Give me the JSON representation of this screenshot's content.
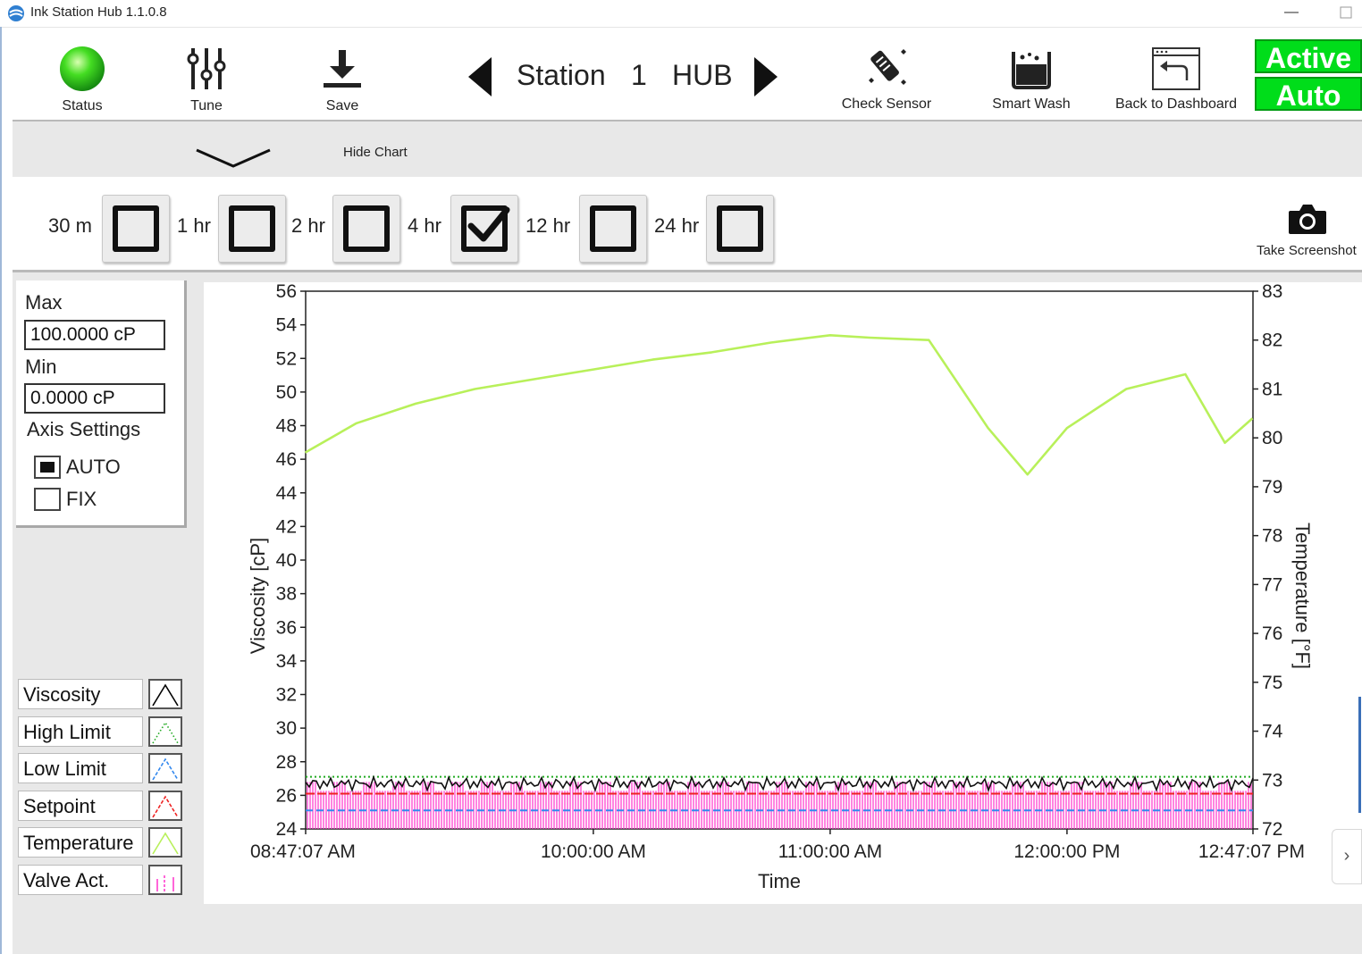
{
  "window": {
    "title": "Ink Station Hub 1.1.0.8",
    "minimize": "—"
  },
  "toolbar": {
    "status_label": "Status",
    "tune_label": "Tune",
    "save_label": "Save",
    "station_word": "Station",
    "station_number": "1",
    "station_name": "HUB",
    "check_sensor_label": "Check Sensor",
    "smart_wash_label": "Smart Wash",
    "back_label": "Back to Dashboard",
    "mode_active": "Active",
    "mode_auto": "Auto",
    "status_color": "#33cc33"
  },
  "chart_toggle": {
    "label": "Hide Chart"
  },
  "range": {
    "options": [
      {
        "label": "30 m",
        "checked": false
      },
      {
        "label": "1 hr",
        "checked": false
      },
      {
        "label": "2 hr",
        "checked": false
      },
      {
        "label": "4 hr",
        "checked": true
      },
      {
        "label": "12 hr",
        "checked": false
      },
      {
        "label": "24 hr",
        "checked": false
      }
    ],
    "screenshot_label": "Take Screenshot"
  },
  "axis_settings": {
    "max_label": "Max",
    "max_value": "100.0000 cP",
    "min_label": "Min",
    "min_value": "0.0000 cP",
    "title": "Axis Settings",
    "auto_label": "AUTO",
    "fix_label": "FIX",
    "selected": "AUTO"
  },
  "legend": {
    "items": [
      {
        "name": "Viscosity",
        "color": "#000000",
        "style": "solid"
      },
      {
        "name": "High Limit",
        "color": "#22aa22",
        "style": "dotted"
      },
      {
        "name": "Low Limit",
        "color": "#3388ee",
        "style": "dashed"
      },
      {
        "name": "Setpoint",
        "color": "#ee2222",
        "style": "dashed"
      },
      {
        "name": "Temperature",
        "color": "#b8f05a",
        "style": "solid"
      },
      {
        "name": "Valve Act.",
        "color": "#ff33cc",
        "style": "impulse"
      }
    ]
  },
  "chart_data": {
    "type": "line",
    "xlabel": "Time",
    "ylabel": "Viscosity [cP]",
    "y2label": "Temperature [°F]",
    "x_range": [
      "08:47:07 AM",
      "12:47:07 PM"
    ],
    "x_ticks": [
      "08:47:07 AM",
      "10:00:00 AM",
      "11:00:00 AM",
      "12:00:00 PM",
      "12:47:07 PM"
    ],
    "ylim": [
      24,
      56
    ],
    "y_ticks": [
      24,
      26,
      28,
      30,
      32,
      34,
      36,
      38,
      40,
      42,
      44,
      46,
      48,
      50,
      52,
      54,
      56
    ],
    "y2lim": [
      72,
      83
    ],
    "y2_ticks": [
      72,
      73,
      74,
      75,
      76,
      77,
      78,
      79,
      80,
      81,
      82,
      83
    ],
    "series": [
      {
        "name": "Temperature",
        "axis": "right",
        "x": [
          "08:47",
          "09:00",
          "09:15",
          "09:30",
          "09:45",
          "10:00",
          "10:15",
          "10:30",
          "10:45",
          "11:00",
          "11:10",
          "11:25",
          "11:40",
          "11:50",
          "12:00",
          "12:15",
          "12:30",
          "12:40",
          "12:47"
        ],
        "values": [
          79.7,
          80.3,
          80.7,
          81.0,
          81.2,
          81.4,
          81.6,
          81.75,
          81.95,
          82.1,
          82.05,
          82.0,
          80.2,
          79.25,
          80.2,
          81.0,
          81.3,
          79.9,
          80.4
        ]
      },
      {
        "name": "Viscosity",
        "axis": "left",
        "values": [
          26.7
        ]
      },
      {
        "name": "High Limit",
        "axis": "left",
        "values": [
          27.1
        ]
      },
      {
        "name": "Setpoint",
        "axis": "left",
        "values": [
          26.1
        ]
      },
      {
        "name": "Low Limit",
        "axis": "left",
        "values": [
          25.1
        ]
      },
      {
        "name": "Valve Act.",
        "axis": "left",
        "values": [
          24.0,
          26.8
        ]
      }
    ]
  }
}
